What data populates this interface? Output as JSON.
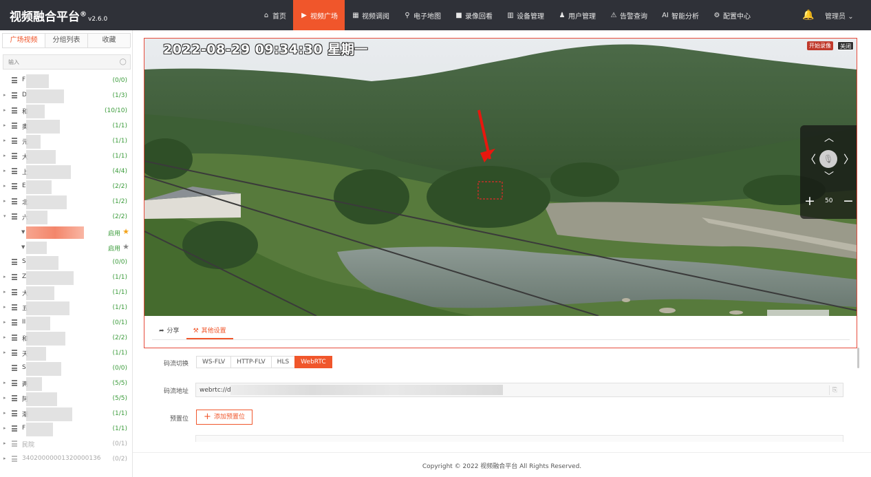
{
  "app": {
    "name": "视频融合平台",
    "reg": "®",
    "version": "v2.6.0"
  },
  "nav": [
    {
      "label": "首页",
      "icon": "dashboard-icon",
      "glyph": "⌂",
      "active": false
    },
    {
      "label": "视频广场",
      "icon": "play-circle-icon",
      "glyph": "▶",
      "active": true
    },
    {
      "label": "视频调阅",
      "icon": "grid-view-icon",
      "glyph": "▦",
      "active": false
    },
    {
      "label": "电子地图",
      "icon": "map-pin-icon",
      "glyph": "⚲",
      "active": false
    },
    {
      "label": "录像回看",
      "icon": "video-camera-icon",
      "glyph": "■",
      "active": false
    },
    {
      "label": "设备管理",
      "icon": "server-icon",
      "glyph": "▥",
      "active": false
    },
    {
      "label": "用户管理",
      "icon": "user-icon",
      "glyph": "♟",
      "active": false
    },
    {
      "label": "告警查询",
      "icon": "alarm-icon",
      "glyph": "⚠",
      "active": false
    },
    {
      "label": "智能分析",
      "icon": "ai-icon",
      "glyph": "AI",
      "active": false
    },
    {
      "label": "配置中心",
      "icon": "gear-icon",
      "glyph": "⚙",
      "active": false
    }
  ],
  "user": {
    "name": "管理员",
    "caret": "⌄"
  },
  "sidebar": {
    "tabs": [
      "广场视频",
      "分组列表",
      "收藏"
    ],
    "active_tab": 0,
    "search_placeholder": "输入",
    "tree": [
      {
        "name": "F",
        "count": "(0/0)",
        "arrow": ""
      },
      {
        "name": "D",
        "count": "(1/3)",
        "arrow": "▸"
      },
      {
        "name": "和",
        "count": "(10/10)",
        "arrow": "▸"
      },
      {
        "name": "奥",
        "count": "(1/1)",
        "arrow": "▸"
      },
      {
        "name": "元",
        "count": "(1/1)",
        "arrow": "▸"
      },
      {
        "name": "大",
        "count": "(1/1)",
        "arrow": "▸"
      },
      {
        "name": "上",
        "count": "(4/4)",
        "arrow": "▸"
      },
      {
        "name": "E",
        "count": "(2/2)",
        "arrow": "▸"
      },
      {
        "name": "北",
        "count": "(1/2)",
        "arrow": "▸"
      },
      {
        "name": "六",
        "count": "(2/2)",
        "arrow": "▾"
      }
    ],
    "channels": [
      {
        "status": "启用",
        "starred": true
      },
      {
        "status": "启用",
        "starred": false
      }
    ],
    "tree2": [
      {
        "name": "S",
        "count": "(0/0)",
        "arrow": ""
      },
      {
        "name": "Z",
        "count": "(1/1)",
        "arrow": "▸"
      },
      {
        "name": "大",
        "count": "(1/1)",
        "arrow": "▸"
      },
      {
        "name": "五",
        "count": "(1/1)",
        "arrow": "▸"
      },
      {
        "name": "II",
        "count": "(0/1)",
        "arrow": "▸"
      },
      {
        "name": "和",
        "count": "(2/2)",
        "arrow": "▸"
      },
      {
        "name": "天",
        "count": "(1/1)",
        "arrow": "▸"
      },
      {
        "name": "S",
        "count": "(0/0)",
        "arrow": ""
      },
      {
        "name": "两",
        "count": "(5/5)",
        "arrow": "▸"
      },
      {
        "name": "阿",
        "count": "(5/5)",
        "arrow": "▸"
      },
      {
        "name": "潮",
        "count": "(1/1)",
        "arrow": "▸"
      },
      {
        "name": "F",
        "count": "(1/1)",
        "arrow": "▸"
      },
      {
        "name": "民院",
        "count": "(0/1)",
        "arrow": "▸",
        "dim": true
      },
      {
        "name": "34020000001320000136",
        "count": "(0/2)",
        "arrow": "▸",
        "dim": true
      }
    ]
  },
  "player": {
    "osd_time": "2022-08-29 09:34:30 星期一",
    "record_label": "开始录像",
    "close_label": "关闭",
    "zoom_value": "50",
    "subtabs": [
      {
        "label": "分享",
        "glyph": "➦",
        "icon": "share-icon"
      },
      {
        "label": "其他设置",
        "glyph": "⚒",
        "icon": "settings-tools-icon"
      }
    ],
    "active_subtab": 1
  },
  "settings": {
    "stream_label": "码流切换",
    "streams": [
      "WS-FLV",
      "HTTP-FLV",
      "HLS",
      "WebRTC"
    ],
    "active_stream": 3,
    "url_label": "码流地址",
    "url_value": "webrtc://d",
    "preset_label": "预置位",
    "add_preset_label": "添加预置位"
  },
  "footer": {
    "copyright": "Copyright © 2022 视频融合平台 All Rights Reserved."
  },
  "colors": {
    "accent": "#f0562b",
    "topbar": "#2f3138",
    "online": "#3a9b3a"
  }
}
